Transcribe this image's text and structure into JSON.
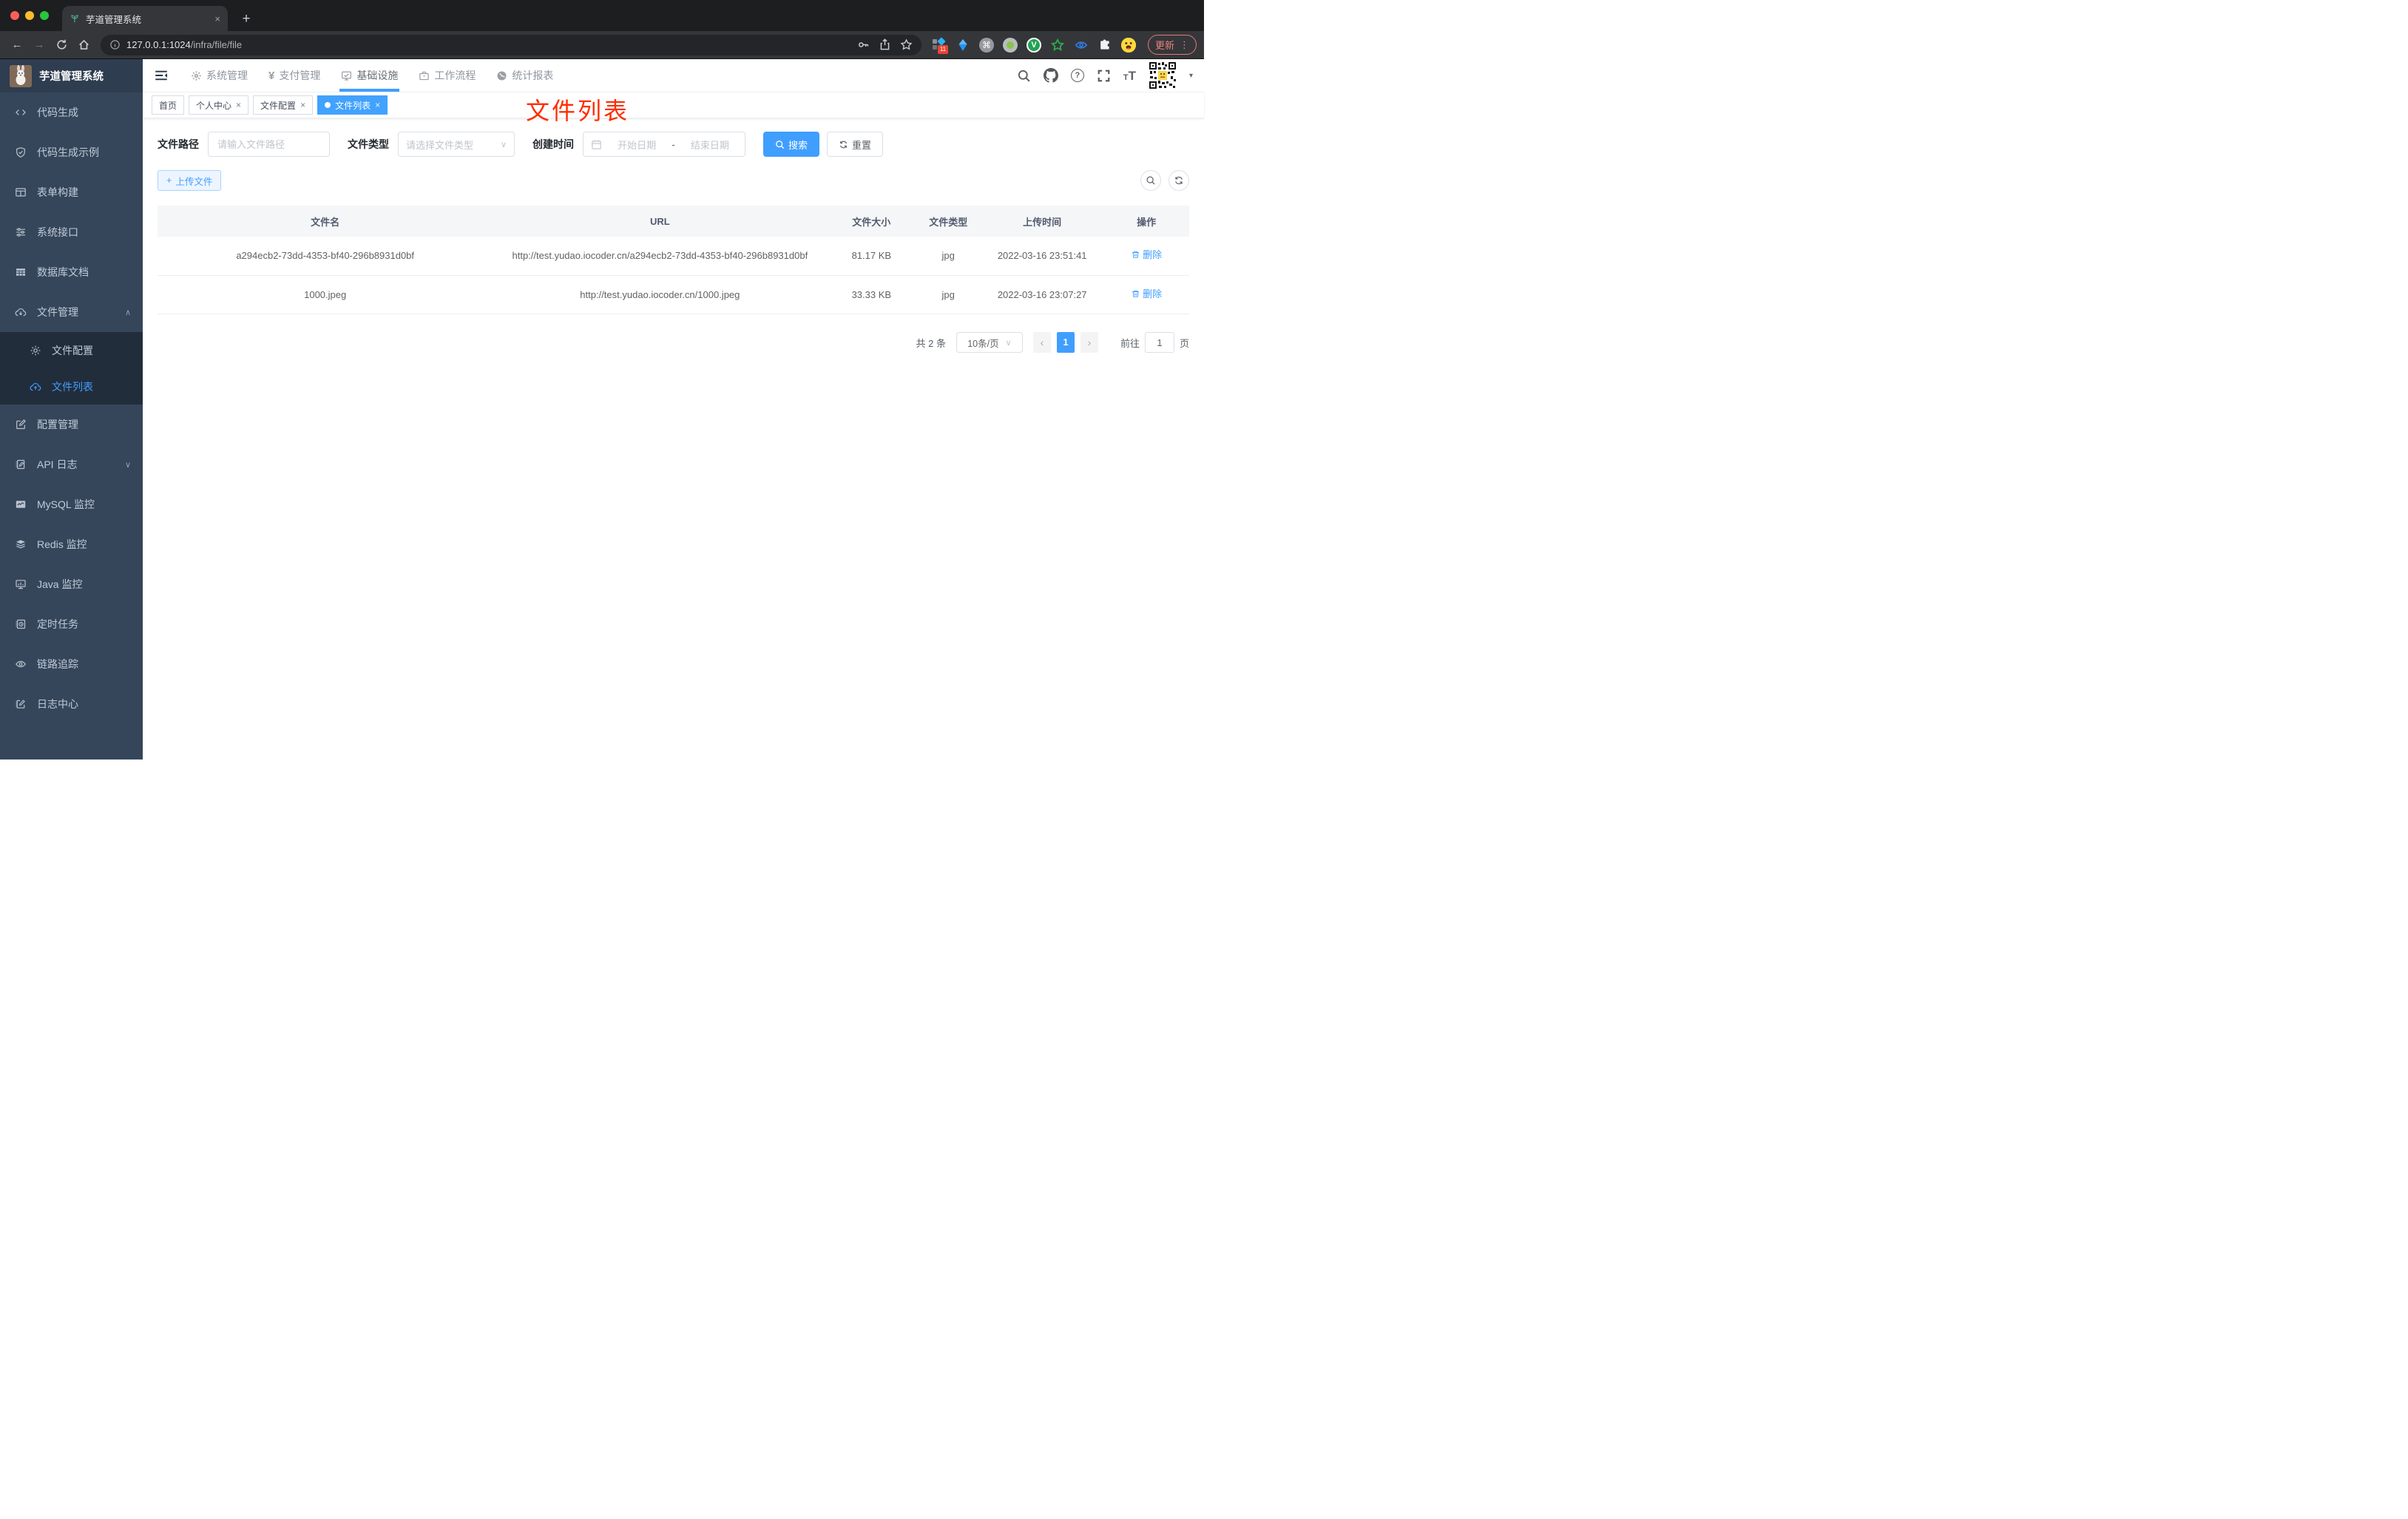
{
  "browser": {
    "tab_title": "芋道管理系统",
    "url_host": "127.0.0.1:1024",
    "url_path": "/infra/file/file",
    "update_label": "更新",
    "extension_badge": "11"
  },
  "glyphs": {
    "close": "×",
    "new_tab": "+",
    "back": "←",
    "forward": "→",
    "kebab": "⋮",
    "command": "⌘",
    "v_letter": "V",
    "caret_down": "∨",
    "caret_up": "∧",
    "triangle_down": "▾",
    "question": "?",
    "yen": "¥",
    "t_small": "T",
    "t_big": "T",
    "plus": "+",
    "prev": "‹",
    "next": "›",
    "dash": "-"
  },
  "app_header": {
    "logo_title": "芋道管理系统",
    "nav": [
      {
        "label": "系统管理"
      },
      {
        "label": "支付管理"
      },
      {
        "label": "基础设施"
      },
      {
        "label": "工作流程"
      },
      {
        "label": "统计报表"
      }
    ]
  },
  "sidebar": {
    "items": [
      {
        "label": "代码生成",
        "icon": "code-icon"
      },
      {
        "label": "代码生成示例",
        "icon": "shield-check-icon"
      },
      {
        "label": "表单构建",
        "icon": "form-icon"
      },
      {
        "label": "系统接口",
        "icon": "sliders-icon"
      },
      {
        "label": "数据库文档",
        "icon": "database-icon"
      },
      {
        "label": "文件管理",
        "icon": "cloud-download-icon"
      },
      {
        "label": "文件配置",
        "icon": "gear-icon"
      },
      {
        "label": "文件列表",
        "icon": "cloud-upload-icon"
      },
      {
        "label": "配置管理",
        "icon": "edit-square-icon"
      },
      {
        "label": "API 日志",
        "icon": "log-icon"
      },
      {
        "label": "MySQL 监控",
        "icon": "chart-monitor-icon"
      },
      {
        "label": "Redis 监控",
        "icon": "layers-icon"
      },
      {
        "label": "Java 监控",
        "icon": "desktop-icon"
      },
      {
        "label": "定时任务",
        "icon": "schedule-icon"
      },
      {
        "label": "链路追踪",
        "icon": "eye-icon"
      },
      {
        "label": "日志中心",
        "icon": "log-center-icon"
      }
    ]
  },
  "tags": {
    "items": [
      {
        "label": "首页"
      },
      {
        "label": "个人中心"
      },
      {
        "label": "文件配置"
      },
      {
        "label": "文件列表"
      }
    ]
  },
  "annotation": "文件列表",
  "filters": {
    "path_label": "文件路径",
    "path_placeholder": "请输入文件路径",
    "type_label": "文件类型",
    "type_placeholder": "请选择文件类型",
    "date_label": "创建时间",
    "date_start_placeholder": "开始日期",
    "date_end_placeholder": "结束日期",
    "search_label": "搜索",
    "reset_label": "重置"
  },
  "toolbar": {
    "upload_label": "上传文件"
  },
  "table": {
    "columns": [
      "文件名",
      "URL",
      "文件大小",
      "文件类型",
      "上传时间",
      "操作"
    ],
    "rows": [
      {
        "name": "a294ecb2-73dd-4353-bf40-296b8931d0bf",
        "url": "http://test.yudao.iocoder.cn/a294ecb2-73dd-4353-bf40-296b8931d0bf",
        "size": "81.17 KB",
        "type": "jpg",
        "time": "2022-03-16 23:51:41",
        "action": "删除"
      },
      {
        "name": "1000.jpeg",
        "url": "http://test.yudao.iocoder.cn/1000.jpeg",
        "size": "33.33 KB",
        "type": "jpg",
        "time": "2022-03-16 23:07:27",
        "action": "删除"
      }
    ]
  },
  "pagination": {
    "total": "共 2 条",
    "page_size": "10条/页",
    "page": "1",
    "goto_label": "前往",
    "goto_value": "1",
    "unit": "页"
  },
  "colors": {
    "accent": "#409eff",
    "annotation_red": "#ff2d00",
    "sidebar_bg": "#36465a",
    "submenu_bg": "#222d3c"
  }
}
